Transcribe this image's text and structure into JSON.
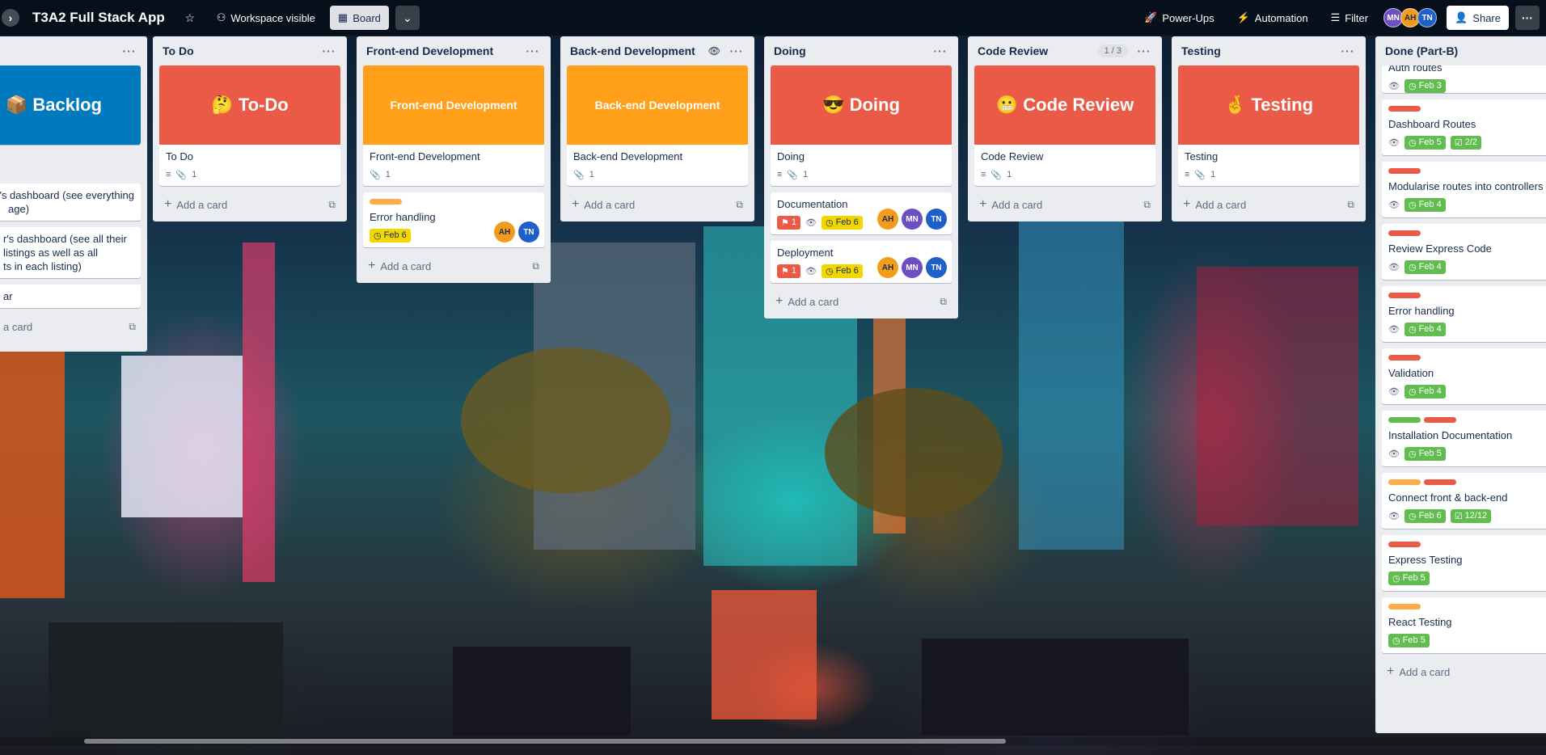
{
  "header": {
    "board_title": "T3A2 Full Stack App",
    "visibility": "Workspace visible",
    "view": "Board",
    "power_ups": "Power-Ups",
    "automation": "Automation",
    "filter": "Filter",
    "members": [
      "MN",
      "AH",
      "TN"
    ],
    "share": "Share"
  },
  "lists": {
    "backlog": {
      "cover_text": "📦 Backlog",
      "cards": [
        "er's dashboard (see everything",
        "age)",
        "r's dashboard (see all their",
        "listings as well as all",
        "ts in each listing)",
        "ar"
      ],
      "add_card": "a card"
    },
    "todo": {
      "name": "To Do",
      "cover_text": "🤔 To-Do",
      "title": "To Do",
      "attachments": "1",
      "add_card": "Add a card"
    },
    "frontend": {
      "name": "Front-end Development",
      "cover_text": "Front-end Development",
      "title": "Front-end Development",
      "attachments": "1",
      "card2": {
        "title": "Error handling",
        "date": "Feb 6",
        "avatars": [
          "AH",
          "TN"
        ]
      },
      "add_card": "Add a card"
    },
    "backend": {
      "name": "Back-end Development",
      "cover_text": "Back-end Development",
      "title": "Back-end Development",
      "attachments": "1",
      "add_card": "Add a card"
    },
    "doing": {
      "name": "Doing",
      "cover_text": "😎 Doing",
      "title": "Doing",
      "attachments": "1",
      "card2": {
        "title": "Documentation",
        "flag": "1",
        "date": "Feb 6",
        "avatars": [
          "AH",
          "MN",
          "TN"
        ]
      },
      "card3": {
        "title": "Deployment",
        "flag": "1",
        "date": "Feb 6",
        "avatars": [
          "AH",
          "MN",
          "TN"
        ]
      },
      "add_card": "Add a card"
    },
    "code_review": {
      "name": "Code Review",
      "count": "1 / 3",
      "cover_text": "😬 Code Review",
      "title": "Code Review",
      "attachments": "1",
      "add_card": "Add a card"
    },
    "testing": {
      "name": "Testing",
      "cover_text": "🤞 Testing",
      "title": "Testing",
      "attachments": "1",
      "add_card": "Add a card"
    },
    "done": {
      "name": "Done (Part-B)",
      "cards": [
        {
          "title": "Auth routes",
          "date": "Feb 3",
          "check": ""
        },
        {
          "title": "Dashboard Routes",
          "date": "Feb 5",
          "check": "2/2"
        },
        {
          "title": "Modularise routes into controllers",
          "date": "Feb 4",
          "check": ""
        },
        {
          "title": "Review Express Code",
          "date": "Feb 4",
          "check": ""
        },
        {
          "title": "Error handling",
          "date": "Feb 4",
          "check": ""
        },
        {
          "title": "Validation",
          "date": "Feb 4",
          "check": ""
        },
        {
          "title": "Installation Documentation",
          "date": "Feb 5",
          "check": ""
        },
        {
          "title": "Connect front & back-end",
          "date": "Feb 6",
          "check": "12/12"
        },
        {
          "title": "Express Testing",
          "date": "Feb 5",
          "check": ""
        },
        {
          "title": "React Testing",
          "date": "Feb 5",
          "check": ""
        }
      ],
      "add_card": "Add a card"
    }
  },
  "colors": {
    "cover_orange_red": "#eb5a46",
    "cover_orange": "#ff9f1a",
    "cover_blue": "#0079bf",
    "label_red": "#eb5a46",
    "label_orange": "#ffab4a",
    "label_green": "#61bd4f",
    "label_yellow": "#f2d600"
  }
}
